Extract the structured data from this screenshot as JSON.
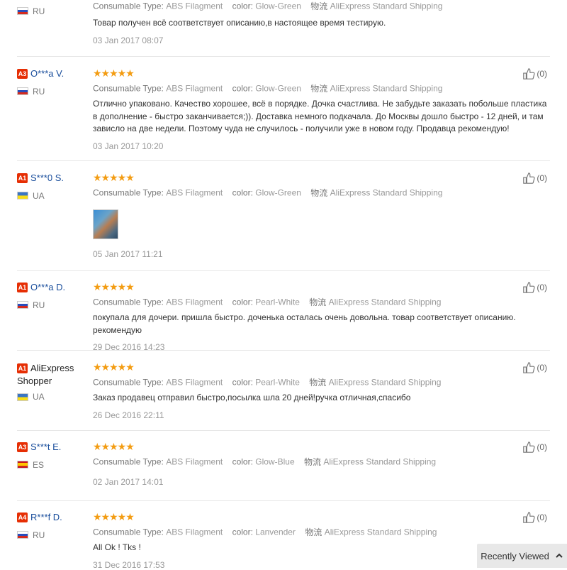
{
  "attr_labels": {
    "consumable": "Consumable Type:",
    "color": "color:",
    "shipping_cn": "物流"
  },
  "reviews": [
    {
      "country": "RU",
      "consumable": "ABS Filagment",
      "color": "Glow-Green",
      "shipping": "AliExpress Standard Shipping",
      "text": "Товар получен всё соответствует описанию,в настоящее время тестирую.",
      "date": "03 Jan 2017 08:07"
    },
    {
      "level": "A3",
      "name": "O***a V.",
      "country": "RU",
      "rating_fraction": 1.0,
      "consumable": "ABS Filagment",
      "color": "Glow-Green",
      "shipping": "AliExpress Standard Shipping",
      "text": "Отлично упаковано. Качество хорошее, всё в порядке. Дочка счастлива. Не забудьте заказать побольше пластика в дополнение - быстро заканчивается;)). Доставка немного подкачала. До Москвы дошло быстро - 12 дней, и там зависло на две недели. Поэтому чуда не случилось - получили уже в новом году. Продавца рекомендую!",
      "date": "03 Jan 2017 10:20",
      "helpful": "(0)"
    },
    {
      "level": "A1",
      "name": "S***0 S.",
      "country": "UA",
      "rating_fraction": 1.0,
      "consumable": "ABS Filagment",
      "color": "Glow-Green",
      "shipping": "AliExpress Standard Shipping",
      "date": "05 Jan 2017 11:21",
      "helpful": "(0)"
    },
    {
      "level": "A1",
      "name": "O***a D.",
      "country": "RU",
      "rating_fraction": 1.0,
      "consumable": "ABS Filagment",
      "color": "Pearl-White",
      "shipping": "AliExpress Standard Shipping",
      "text": "покупала для дочери. пришла быстро. доченька осталась очень довольна. товар соответствует описанию. рекомендую",
      "date": "29 Dec 2016 14:23",
      "helpful": "(0)"
    },
    {
      "level": "A1",
      "name_line1": "AliExpress",
      "name_line2": "Shopper",
      "country": "UA",
      "rating_fraction": 1.0,
      "consumable": "ABS Filagment",
      "color": "Pearl-White",
      "shipping": "AliExpress Standard Shipping",
      "text": "Заказ продавец отправил быстро,посылка шла 20 дней!ручка отличная,спасибо",
      "date": "26 Dec 2016 22:11",
      "helpful": "(0)"
    },
    {
      "level": "A3",
      "name": "S***t E.",
      "country": "ES",
      "rating_fraction": 1.0,
      "consumable": "ABS Filagment",
      "color": "Glow-Blue",
      "shipping": "AliExpress Standard Shipping",
      "date": "02 Jan 2017 14:01",
      "helpful": "(0)"
    },
    {
      "level": "A4",
      "name": "R***f D.",
      "country": "RU",
      "rating_fraction": 1.0,
      "consumable": "ABS Filagment",
      "color": "Lanvender",
      "shipping": "AliExpress Standard Shipping",
      "text": "All Ok ! Tks !",
      "date": "31 Dec 2016 17:53",
      "helpful": "(0)"
    }
  ],
  "recently_viewed": "Recently Viewed",
  "colors": {
    "badge": "#e62e04",
    "name_link": "#1a4e9c",
    "stars": "#f39c12"
  },
  "icons": {
    "helpful": "thumbs-up-icon",
    "recently_viewed": "chevron-up-icon"
  }
}
